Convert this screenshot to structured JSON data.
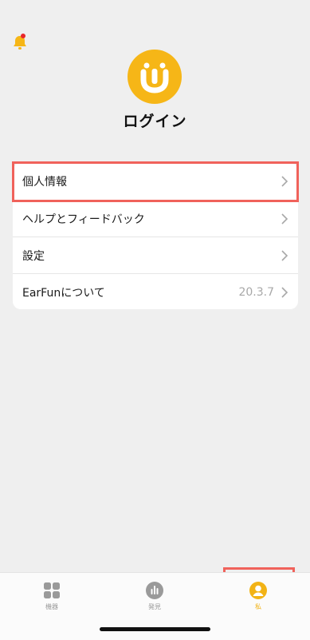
{
  "header": {
    "bell_icon": "bell-icon",
    "notification_dot": true
  },
  "profile": {
    "logo_icon": "earfun-logo-icon",
    "login_label": "ログイン"
  },
  "menu": {
    "items": [
      {
        "label": "個人情報",
        "value": ""
      },
      {
        "label": "ヘルプとフィードバック",
        "value": ""
      },
      {
        "label": "設定",
        "value": ""
      },
      {
        "label": "EarFunについて",
        "value": "20.3.7"
      }
    ]
  },
  "tabbar": {
    "tabs": [
      {
        "label": "機器",
        "icon": "grid-icon",
        "active": false
      },
      {
        "label": "発見",
        "icon": "bars-icon",
        "active": false
      },
      {
        "label": "私",
        "icon": "person-icon",
        "active": true
      }
    ]
  },
  "colors": {
    "accent": "#f6b617",
    "highlight": "#f0625b",
    "background": "#efefef"
  }
}
